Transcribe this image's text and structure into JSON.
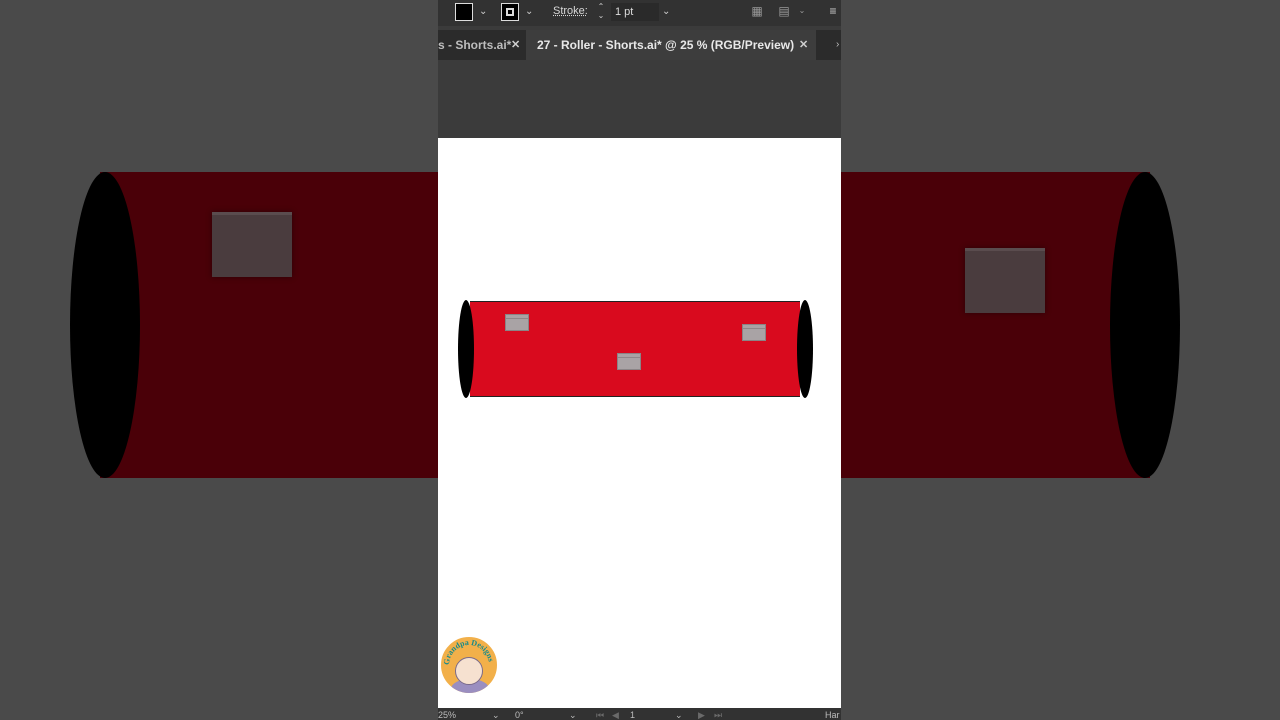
{
  "control_bar": {
    "stroke_label": "Stroke:",
    "stroke_weight": "1 pt"
  },
  "tabs": [
    {
      "label": "s - Shorts.ai*",
      "active": false
    },
    {
      "label": "27 - Roller - Shorts.ai* @ 25 % (RGB/Preview)",
      "active": true
    }
  ],
  "close_glyph": "✕",
  "status_bar": {
    "zoom": "25%",
    "rotation": "0°",
    "artboard": "1",
    "tool_hint": "Har"
  },
  "logo_text": "Grandpa Designs",
  "colors": {
    "roller_red": "#d90a1e",
    "end_caps": "#000000",
    "window_gray": "#a9a3a5",
    "artboard": "#ffffff",
    "ui_dark": "#323232"
  },
  "icons": [
    "fill-swatch",
    "stroke-swatch",
    "chevron-down-icon",
    "stepper-icon",
    "align-icon",
    "close-icon",
    "menu-icon"
  ]
}
